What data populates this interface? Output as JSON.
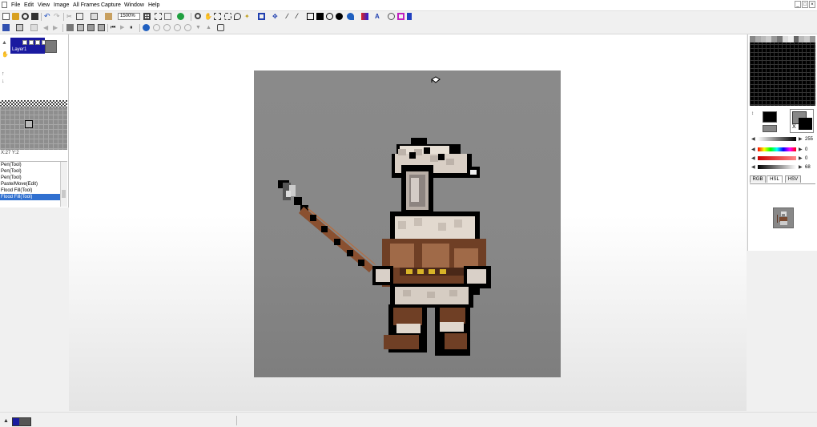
{
  "menu": [
    "File",
    "Edit",
    "View",
    "Image",
    "All Frames",
    "Capture",
    "Window",
    "Help"
  ],
  "toolbar": {
    "zoom": "1500%"
  },
  "layers": {
    "name": "Layer1"
  },
  "status": {
    "coord": "X:27 Y:2"
  },
  "history": [
    "Pen(Tool)",
    "Pen(Tool)",
    "Pen(Tool)",
    "Paste/Move(Edit)",
    "Flood Fill(Tool)",
    "Flood Fill(Tool)"
  ],
  "color": {
    "slider_values": [
      "255",
      "0",
      "0",
      "68"
    ],
    "tabs": [
      "RGB",
      "HSL",
      "HSV"
    ],
    "active_tab": "HSL"
  },
  "window_buttons": [
    "_",
    "□",
    "×"
  ]
}
